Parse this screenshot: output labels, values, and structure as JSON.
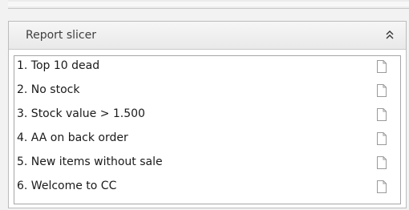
{
  "panel": {
    "title": "Report slicer",
    "collapse_icon": "chevrons-up-icon"
  },
  "reports": [
    {
      "label": "1. Top 10 dead",
      "icon": "document-icon"
    },
    {
      "label": "2. No stock",
      "icon": "document-icon"
    },
    {
      "label": "3. Stock value > 1.500",
      "icon": "document-icon"
    },
    {
      "label": "4. AA on back order",
      "icon": "document-icon"
    },
    {
      "label": "5. New items without sale",
      "icon": "document-icon"
    },
    {
      "label": "6. Welcome to CC",
      "icon": "document-icon"
    }
  ],
  "colors": {
    "header_bg": "#eeeeee",
    "border": "#a6a6a6",
    "text": "#1a1a1a"
  }
}
